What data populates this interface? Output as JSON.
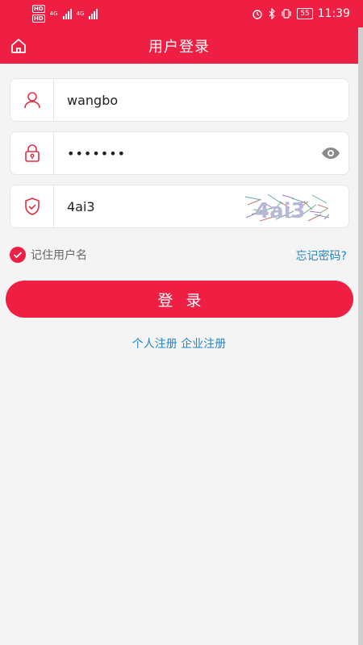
{
  "status_bar": {
    "badges": [
      "HD",
      "HD"
    ],
    "network": [
      "4G",
      "4G"
    ],
    "battery": "55",
    "time": "11:39"
  },
  "header": {
    "title": "用户登录",
    "home_icon": "home-icon"
  },
  "form": {
    "username": {
      "value": "wangbo",
      "icon": "user-icon"
    },
    "password": {
      "value": "•••••••",
      "icon": "lock-icon",
      "toggle_icon": "eye-icon"
    },
    "captcha": {
      "value": "4ai3",
      "icon": "shield-check-icon",
      "image_text": "4ai3"
    }
  },
  "options": {
    "remember_label": "记住用户名",
    "remember_checked": true,
    "forgot_label": "忘记密码?"
  },
  "login_button": "登录",
  "register": {
    "personal": "个人注册",
    "enterprise": "企业注册"
  },
  "colors": {
    "brand": "#ee1f43",
    "link": "#1f86c9"
  }
}
